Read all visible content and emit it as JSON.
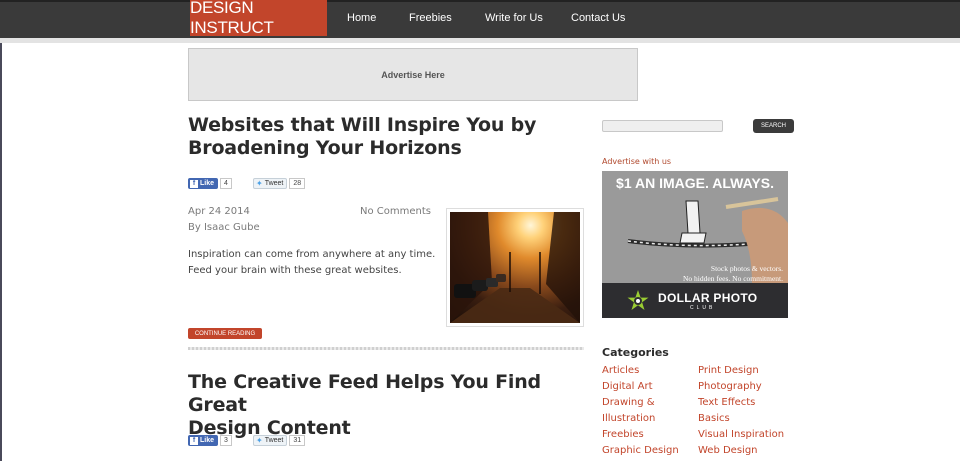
{
  "header": {
    "logo": "DESIGN INSTRUCT",
    "nav": [
      {
        "label": "Home"
      },
      {
        "label": "Freebies"
      },
      {
        "label": "Write for Us"
      },
      {
        "label": "Contact Us"
      }
    ]
  },
  "top_ad": {
    "label": "Advertise Here"
  },
  "posts": [
    {
      "title_line1": "Websites that Will Inspire You by",
      "title_line2": "Broadening Your Horizons",
      "like_label": "Like",
      "like_count": "4",
      "tweet_label": "Tweet",
      "tweet_count": "28",
      "date": "Apr 24 2014",
      "author": "By Isaac Gube",
      "comments": "No Comments",
      "excerpt_line1": "Inspiration can come from anywhere at any time.",
      "excerpt_line2": "Feed your brain with these great websites.",
      "continue_label": "CONTINUE READING"
    },
    {
      "title_line1": "The Creative Feed Helps You Find Great",
      "title_line2": "Design Content",
      "like_label": "Like",
      "like_count": "3",
      "tweet_label": "Tweet",
      "tweet_count": "31"
    }
  ],
  "sidebar": {
    "search_button": "SEARCH",
    "advertise_label": "Advertise with us",
    "ad": {
      "headline": "$1 AN IMAGE. ALWAYS.",
      "sub_line1": "Stock photos & vectors.",
      "sub_line2": "No hidden fees. No commitment.",
      "brand": "DOLLAR PHOTO",
      "brand_sub": "CLUB"
    },
    "categories_heading": "Categories",
    "categories_left": [
      "Articles",
      "Digital Art",
      "Drawing &",
      "Illustration",
      "Freebies",
      "Graphic Design"
    ],
    "categories_right": [
      "Print Design",
      "Photography",
      "Text Effects",
      "Basics",
      "Visual Inspiration",
      "Web Design"
    ]
  },
  "colors": {
    "brand": "#c2452b",
    "topbar": "#3a3a3a",
    "link": "#c2452b"
  }
}
